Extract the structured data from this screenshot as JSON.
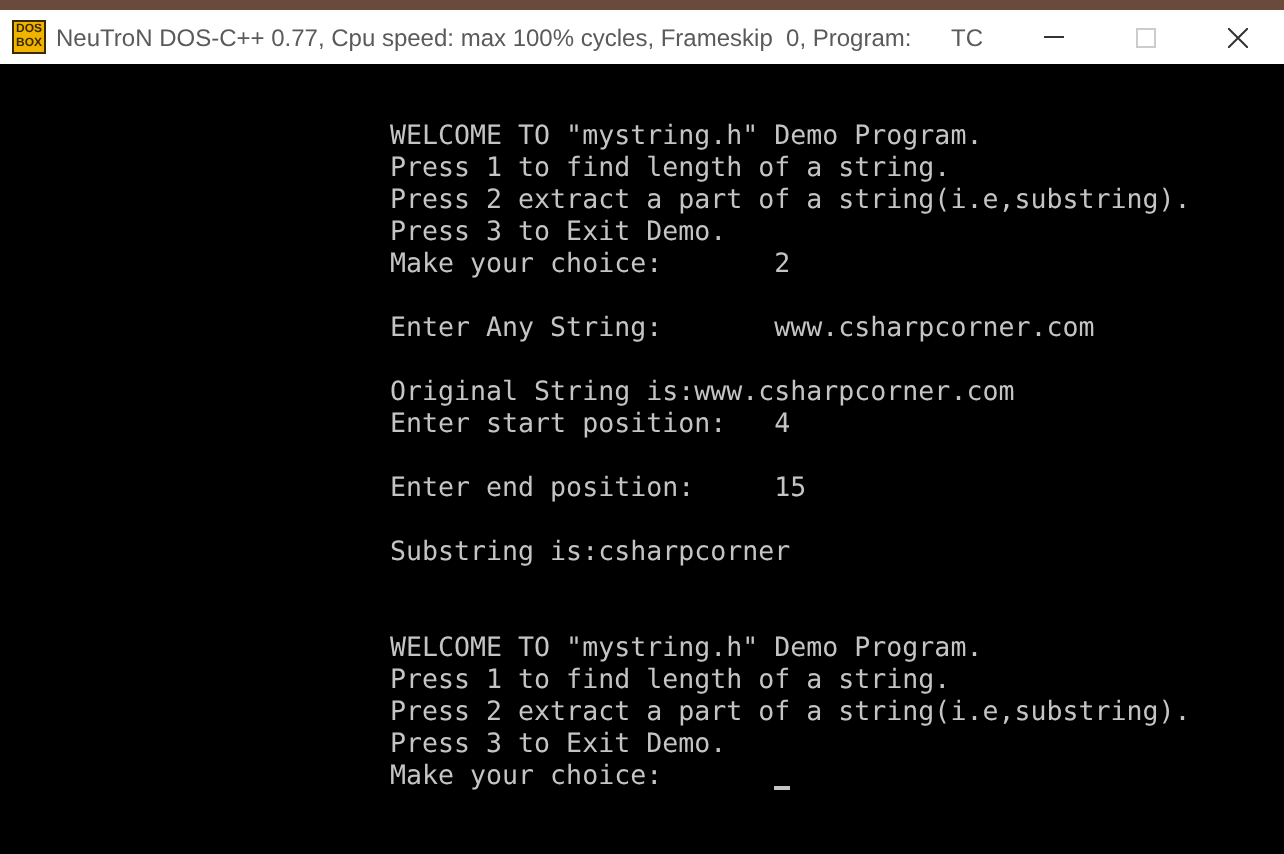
{
  "window": {
    "title": "NeuTroN DOS-C++ 0.77, Cpu speed: max 100% cycles, Frameskip  0, Program:      TC",
    "icon_text": [
      "DOS",
      "BOX"
    ],
    "maximize_disabled": true
  },
  "console": {
    "lines": [
      {
        "kind": "text",
        "text": "WELCOME TO \"mystring.h\" Demo Program."
      },
      {
        "kind": "text",
        "text": "Press 1 to find length of a string."
      },
      {
        "kind": "text",
        "text": "Press 2 extract a part of a string(i.e,substring)."
      },
      {
        "kind": "text",
        "text": "Press 3 to Exit Demo."
      },
      {
        "kind": "text",
        "text": "Make your choice:       2"
      },
      {
        "kind": "blank"
      },
      {
        "kind": "text",
        "text": "Enter Any String:       www.csharpcorner.com"
      },
      {
        "kind": "blank"
      },
      {
        "kind": "text",
        "text": "Original String is:www.csharpcorner.com"
      },
      {
        "kind": "text",
        "text": "Enter start position:   4"
      },
      {
        "kind": "blank"
      },
      {
        "kind": "text",
        "text": "Enter end position:     15"
      },
      {
        "kind": "blank"
      },
      {
        "kind": "text",
        "text": "Substring is:csharpcorner"
      },
      {
        "kind": "blank"
      },
      {
        "kind": "blank"
      },
      {
        "kind": "text",
        "text": "WELCOME TO \"mystring.h\" Demo Program."
      },
      {
        "kind": "text",
        "text": "Press 1 to find length of a string."
      },
      {
        "kind": "text",
        "text": "Press 2 extract a part of a string(i.e,substring)."
      },
      {
        "kind": "text",
        "text": "Press 3 to Exit Demo."
      },
      {
        "kind": "prompt",
        "text": "Make your choice:       ",
        "cursor": true
      }
    ]
  }
}
